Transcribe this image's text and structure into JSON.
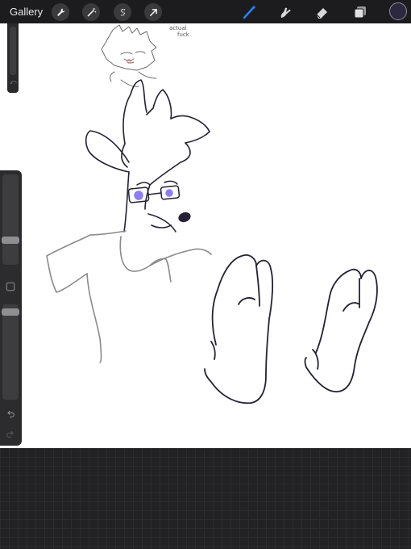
{
  "topbar": {
    "gallery_label": "Gallery",
    "tools_left": [
      "wrench-icon",
      "magic-wand-icon",
      "selection-s-icon",
      "transform-arrow-icon"
    ],
    "tools_right": [
      "brush-icon",
      "smudge-icon",
      "eraser-icon",
      "layers-icon"
    ],
    "active_tool": "brush",
    "active_color": "#2b2840",
    "brush_color": "#2f7df6"
  },
  "canvas": {
    "annotation_line1": "actual",
    "annotation_line2": "fuck"
  },
  "sidebar": {
    "brush_size_level": 0.25,
    "opacity_level": 0.95,
    "undo_icon": "undo-icon",
    "redo_icon": "redo-icon",
    "modify_icon": "square-modify-icon"
  }
}
